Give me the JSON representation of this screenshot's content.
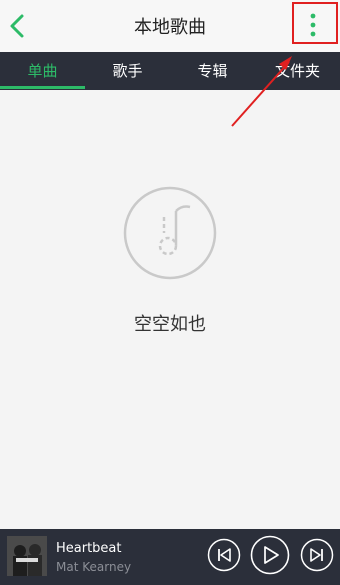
{
  "header": {
    "title": "本地歌曲",
    "back_icon": "chevron-left-icon",
    "more_icon": "more-vertical-icon"
  },
  "tabs": [
    {
      "label": "单曲",
      "active": true
    },
    {
      "label": "歌手",
      "active": false
    },
    {
      "label": "专辑",
      "active": false
    },
    {
      "label": "文件夹",
      "active": false
    }
  ],
  "empty_state": {
    "icon": "music-note-disc-icon",
    "message": "空空如也"
  },
  "player": {
    "song_title": "Heartbeat",
    "artist": "Mat Kearney",
    "controls": [
      "previous-icon",
      "play-icon",
      "next-icon"
    ]
  },
  "colors": {
    "accent": "#2dbb68",
    "bar_bg": "#2b2f3a",
    "page_bg": "#f4f4f4",
    "annotation": "#e02020"
  }
}
